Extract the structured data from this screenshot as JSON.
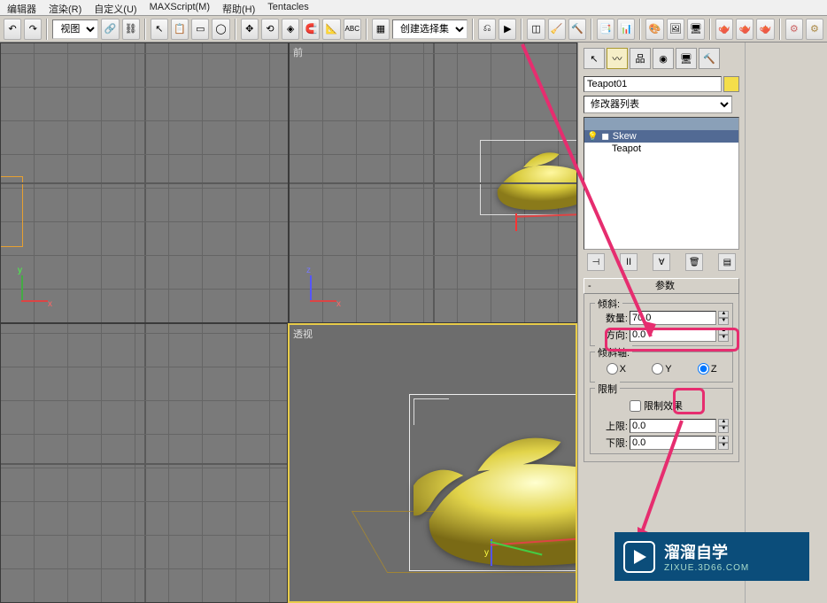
{
  "menu": {
    "m1": "编辑器",
    "m2": "渲染(R)",
    "m3": "自定义(U)",
    "m4": "MAXScript(M)",
    "m5": "帮助(H)",
    "m6": "Tentacles"
  },
  "toolbar": {
    "view_dd": "视图",
    "selset_dd": "创建选择集"
  },
  "viewports": {
    "front": "前",
    "persp": "透视",
    "axis_x": "x",
    "axis_y": "y",
    "axis_z": "z"
  },
  "panel": {
    "object_name": "Teapot01",
    "modifier_list": "修改器列表",
    "stack_skew": "Skew",
    "stack_teapot": "Teapot",
    "rollout_title": "参数",
    "skew_group": "倾斜:",
    "amount_label": "数量:",
    "amount_value": "70.0",
    "direction_label": "方向:",
    "direction_value": "0.0",
    "axis_group": "倾斜轴:",
    "axis_x": "X",
    "axis_y": "Y",
    "axis_z": "Z",
    "limit_group": "限制",
    "limit_effect": "限制效果",
    "upper_label": "上限:",
    "upper_value": "0.0",
    "lower_label": "下限:",
    "lower_value": "0.0"
  },
  "watermark": {
    "brand": "溜溜自学",
    "url": "ZIXUE.3D66.COM"
  }
}
